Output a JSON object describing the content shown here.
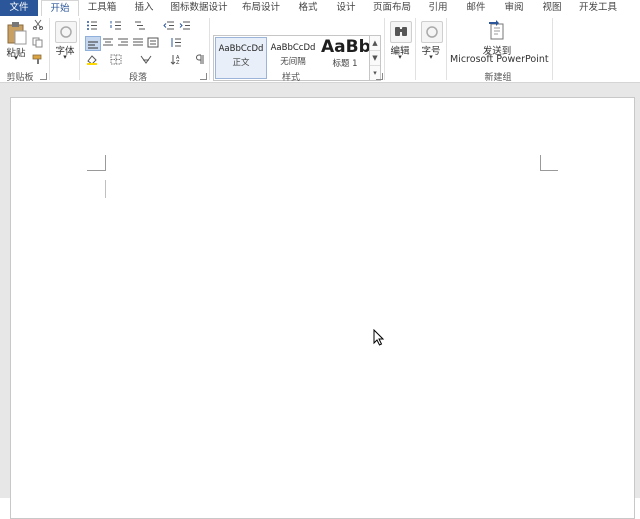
{
  "tabs": [
    {
      "label": "文件"
    },
    {
      "label": "开始"
    },
    {
      "label": "工具箱"
    },
    {
      "label": "插入"
    },
    {
      "label": "图标数据设计"
    },
    {
      "label": "布局设计"
    },
    {
      "label": "格式"
    },
    {
      "label": "设计"
    },
    {
      "label": "页面布局"
    },
    {
      "label": "引用"
    },
    {
      "label": "邮件"
    },
    {
      "label": "审阅"
    },
    {
      "label": "视图"
    },
    {
      "label": "开发工具"
    }
  ],
  "ribbon": {
    "clipboard": {
      "paste_label": "粘贴",
      "group_label": "剪贴板"
    },
    "font": {
      "button_label": "字体"
    },
    "paragraph": {
      "group_label": "段落"
    },
    "styles": {
      "items": [
        {
          "sample": "AaBbCcDd",
          "name": "正文"
        },
        {
          "sample": "AaBbCcDd",
          "name": "无间隔"
        },
        {
          "sample": "AaBb",
          "name": "标题 1"
        }
      ],
      "group_label": "样式"
    },
    "editing": {
      "button_label": "编辑"
    },
    "font_size": {
      "button_label": "字号"
    },
    "new_group": {
      "button_line1": "发送到",
      "button_line2": "Microsoft PowerPoint",
      "group_label": "新建组"
    }
  },
  "colors": {
    "file_tab": "#2b579a",
    "accent": "#2b579a",
    "doc_bg": "#e7e7e7"
  }
}
